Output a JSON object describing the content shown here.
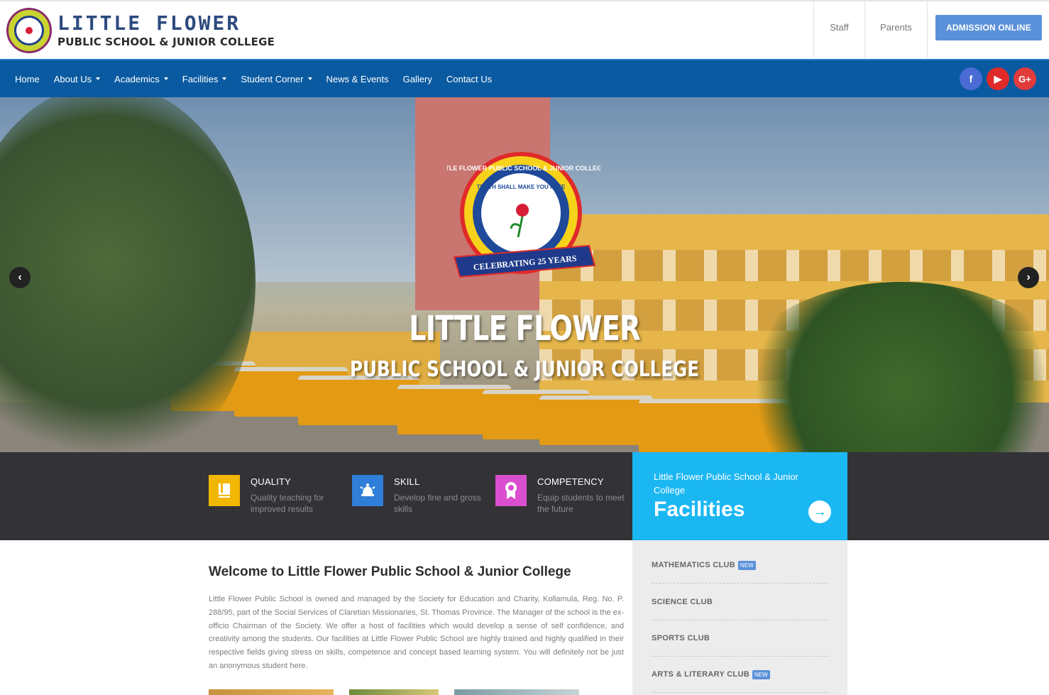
{
  "header": {
    "logo_line1": "LITTLE FLOWER",
    "logo_line2": "PUBLIC SCHOOL & JUNIOR COLLEGE",
    "links": {
      "staff": "Staff",
      "parents": "Parents"
    },
    "admission_label": "ADMISSION ONLINE"
  },
  "nav": {
    "items": [
      {
        "label": "Home",
        "dropdown": false
      },
      {
        "label": "About Us",
        "dropdown": true
      },
      {
        "label": "Academics",
        "dropdown": true
      },
      {
        "label": "Facilities",
        "dropdown": true
      },
      {
        "label": "Student Corner",
        "dropdown": true
      },
      {
        "label": "News & Events",
        "dropdown": false
      },
      {
        "label": "Gallery",
        "dropdown": false
      },
      {
        "label": "Contact Us",
        "dropdown": false
      }
    ],
    "social": [
      {
        "icon": "facebook-icon",
        "glyph": "f",
        "color": "#4a6bd3"
      },
      {
        "icon": "youtube-icon",
        "glyph": "▶",
        "color": "#e02a2a"
      },
      {
        "icon": "google-plus-icon",
        "glyph": "G+",
        "color": "#e23b3b"
      }
    ]
  },
  "hero": {
    "badge_motto": "TRUTH SHALL MAKE YOU FREE",
    "badge_ring": "LITTLE FLOWER PUBLIC SCHOOL & JUNIOR COLLEGE",
    "badge_ribbon": "CELEBRATING 25 YEARS",
    "title": "LITTLE FLOWER",
    "subtitle": "PUBLIC SCHOOL & JUNIOR COLLEGE",
    "prev_glyph": "‹",
    "next_glyph": "›"
  },
  "features": [
    {
      "title": "QUALITY",
      "desc": "Quality teaching for improved results",
      "icon": "book-icon",
      "color": "#f2b705"
    },
    {
      "title": "SKILL",
      "desc": "Develop fine and gross skills",
      "icon": "bell-icon",
      "color": "#2f7ed8"
    },
    {
      "title": "COMPETENCY",
      "desc": "Equip students to meet the future",
      "icon": "award-icon",
      "color": "#d94fd0"
    }
  ],
  "facilities_box": {
    "subtitle": "Little Flower Public School & Junior College",
    "title": "Facilities",
    "arrow_glyph": "→"
  },
  "welcome": {
    "title": "Welcome to Little Flower Public School & Junior College",
    "body": "Little Flower Public School is owned and managed by the Society for Education and Charity, Kollamula, Reg. No. P. 288/95, part of the Social Services of Claretian Missionaries, St. Thomas Province. The Manager of the school is the ex-officio Chairman of the Society. We offer a host of facilities which would develop a sense of self confidence, and creativity among the students. Our facilities at Little Flower Public School are highly trained and highly qualified in their respective fields giving stress on skills, competence and concept based learning system. You will definitely not be just an anonymous student here."
  },
  "clubs": [
    {
      "label": "MATHEMATICS CLUB",
      "badge": "NEW"
    },
    {
      "label": "SCIENCE CLUB",
      "badge": ""
    },
    {
      "label": "SPORTS CLUB",
      "badge": ""
    },
    {
      "label": "ARTS & LITERARY CLUB",
      "badge": "NEW"
    }
  ],
  "colors": {
    "nav_blue": "#0a5aa1",
    "admission_blue": "#5b91d9",
    "facilities_cyan": "#1bb7f2",
    "band_dark": "#333236"
  }
}
